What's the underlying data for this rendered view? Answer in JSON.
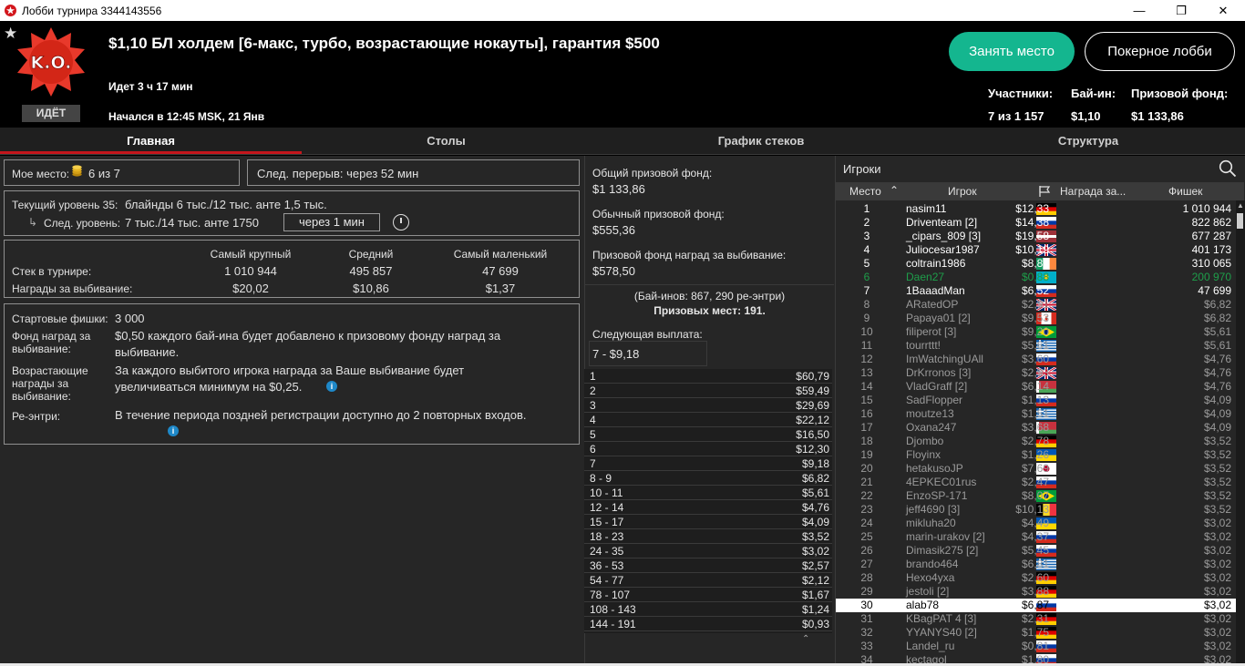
{
  "window": {
    "title": "Лобби турнира 3344143556"
  },
  "header": {
    "tournament_name": "$1,10 БЛ холдем [6-макс, турбо, возрастающие нокауты], гарантия $500",
    "logo_text": "K.O.",
    "status": "ИДЁТ",
    "running": "Идет 3 ч 17 мин",
    "started": "Начался в 12:45 MSK, 21 Янв",
    "take_seat": "Занять место",
    "poker_lobby": "Покерное лобби",
    "stats": [
      {
        "label": "Участники:",
        "value": "7 из 1 157"
      },
      {
        "label": "Бай-ин:",
        "value": "$1,10"
      },
      {
        "label": "Призовой фонд:",
        "value": "$1 133,86"
      }
    ]
  },
  "tabs": [
    "Главная",
    "Столы",
    "График стеков",
    "Структура"
  ],
  "main": {
    "my_place_label": "Мое место:",
    "my_place_value": "6 из 7",
    "next_break": "След. перерыв: через 52 мин",
    "current_level": "Текущий уровень 35:",
    "current_blinds": "блайнды 6 тыс./12 тыс. анте 1,5 тыс.",
    "next_level": "След. уровень:",
    "next_blinds": "7 тыс./14 тыс. анте 1750",
    "next_in": "через 1 мин",
    "stack_cols": [
      "Самый крупный",
      "Средний",
      "Самый маленький"
    ],
    "stack_rows": [
      {
        "label": "Стек в турнире:",
        "values": [
          "1 010 944",
          "495 857",
          "47 699"
        ]
      },
      {
        "label": "Награды за выбивание:",
        "values": [
          "$20,02",
          "$10,86",
          "$1,37"
        ]
      }
    ],
    "info": [
      {
        "label": "Стартовые фишки:",
        "text": "3 000"
      },
      {
        "label": "Фонд наград за выбивание:",
        "text": "$0,50 каждого бай-ина будет добавлено к призовому фонду наград за выбивание."
      },
      {
        "label": "Возрастающие награды за выбивание:",
        "text": "За каждого выбитого игрока награда за Ваше выбивание будет увеличиваться минимум на $0,25."
      },
      {
        "label": "Ре-энтри:",
        "text": "В течение периода поздней регистрации доступно до 2 повторных входов."
      }
    ]
  },
  "prize": {
    "total_label": "Общий призовой фонд:",
    "total": "$1 133,86",
    "regular_label": "Обычный призовой фонд:",
    "regular": "$555,36",
    "bounty_label": "Призовой фонд наград за выбивание:",
    "bounty": "$578,50",
    "buyins": "(Бай-инов: 867, 290 ре-энтри)",
    "paid_places": "Призовых мест: 191.",
    "next_payout_label": "Следующая выплата:",
    "next_payout": "7 - $9,18",
    "payouts": [
      [
        "1",
        "$60,79"
      ],
      [
        "2",
        "$59,49"
      ],
      [
        "3",
        "$29,69"
      ],
      [
        "4",
        "$22,12"
      ],
      [
        "5",
        "$16,50"
      ],
      [
        "6",
        "$12,30"
      ],
      [
        "7",
        "$9,18"
      ],
      [
        "8 - 9",
        "$6,82"
      ],
      [
        "10 - 11",
        "$5,61"
      ],
      [
        "12 - 14",
        "$4,76"
      ],
      [
        "15 - 17",
        "$4,09"
      ],
      [
        "18 - 23",
        "$3,52"
      ],
      [
        "24 - 35",
        "$3,02"
      ],
      [
        "36 - 53",
        "$2,57"
      ],
      [
        "54 - 77",
        "$2,12"
      ],
      [
        "78 - 107",
        "$1,67"
      ],
      [
        "108 - 143",
        "$1,24"
      ],
      [
        "144 - 191",
        "$0,93"
      ]
    ]
  },
  "players": {
    "title": "Игроки",
    "columns": [
      "Место",
      "Игрок",
      "Награда за...",
      "Фишек"
    ],
    "rows": [
      {
        "p": "1",
        "n": "nasim11",
        "f": "de",
        "b": "$12,33",
        "c": "1 010 944",
        "s": "in"
      },
      {
        "p": "2",
        "n": "Driventeam [2]",
        "f": "ru",
        "b": "$14,38",
        "c": "822 862",
        "s": "in"
      },
      {
        "p": "3",
        "n": "_cipars_809 [3]",
        "f": "lv",
        "b": "$19,58",
        "c": "677 287",
        "s": "in"
      },
      {
        "p": "4",
        "n": "Juliocesar1987",
        "f": "gb",
        "b": "$10,19",
        "c": "401 173",
        "s": "in"
      },
      {
        "p": "5",
        "n": "coltrain1986",
        "f": "ie",
        "b": "$8,89",
        "c": "310 065",
        "s": "in"
      },
      {
        "p": "6",
        "n": "Daen27",
        "f": "kz",
        "b": "$0,88",
        "c": "200 970",
        "s": "me"
      },
      {
        "p": "7",
        "n": "1BaaadMan",
        "f": "ru",
        "b": "$6,52",
        "c": "47 699",
        "s": "in"
      },
      {
        "p": "8",
        "n": "ARatedOP",
        "f": "gb",
        "b": "$2,91",
        "c": "$6,82",
        "s": "out"
      },
      {
        "p": "9",
        "n": "Papaya01 [2]",
        "f": "ca",
        "b": "$9,53",
        "c": "$6,82",
        "s": "out"
      },
      {
        "p": "10",
        "n": "filiperot [3]",
        "f": "br",
        "b": "$9,20",
        "c": "$5,61",
        "s": "out"
      },
      {
        "p": "11",
        "n": "tourrttt!",
        "f": "gr",
        "b": "$5,61",
        "c": "$5,61",
        "s": "out"
      },
      {
        "p": "12",
        "n": "ImWatchingUAll",
        "f": "ru",
        "b": "$3,60",
        "c": "$4,76",
        "s": "out"
      },
      {
        "p": "13",
        "n": "DrKrronos [3]",
        "f": "gb",
        "b": "$2,93",
        "c": "$4,76",
        "s": "out"
      },
      {
        "p": "14",
        "n": "VladGraff [2]",
        "f": "by",
        "b": "$6,14",
        "c": "$4,76",
        "s": "out"
      },
      {
        "p": "15",
        "n": "SadFlopper",
        "f": "ru",
        "b": "$1,13",
        "c": "$4,09",
        "s": "out"
      },
      {
        "p": "16",
        "n": "moutze13",
        "f": "gr",
        "b": "$1,51",
        "c": "$4,09",
        "s": "out"
      },
      {
        "p": "17",
        "n": "Oxana247",
        "f": "by",
        "b": "$3,68",
        "c": "$4,09",
        "s": "out"
      },
      {
        "p": "18",
        "n": "Djombo",
        "f": "de",
        "b": "$2,78",
        "c": "$3,52",
        "s": "out"
      },
      {
        "p": "19",
        "n": "Floyinx",
        "f": "ua",
        "b": "$1,26",
        "c": "$3,52",
        "s": "out"
      },
      {
        "p": "20",
        "n": "hetakusoJP",
        "f": "jp",
        "b": "$7,69",
        "c": "$3,52",
        "s": "out"
      },
      {
        "p": "21",
        "n": "4EPKEC01rus",
        "f": "ru",
        "b": "$2,47",
        "c": "$3,52",
        "s": "out"
      },
      {
        "p": "22",
        "n": "EnzoSP-171",
        "f": "br",
        "b": "$8,07",
        "c": "$3,52",
        "s": "out"
      },
      {
        "p": "23",
        "n": "jeff4690 [3]",
        "f": "be",
        "b": "$10,13",
        "c": "$3,52",
        "s": "out"
      },
      {
        "p": "24",
        "n": "mikluha20",
        "f": "ua",
        "b": "$4,49",
        "c": "$3,02",
        "s": "out"
      },
      {
        "p": "25",
        "n": "marin-urakov [2]",
        "f": "ru",
        "b": "$4,37",
        "c": "$3,02",
        "s": "out"
      },
      {
        "p": "26",
        "n": "Dimasik275 [2]",
        "f": "ru",
        "b": "$5,45",
        "c": "$3,02",
        "s": "out"
      },
      {
        "p": "27",
        "n": "brando464",
        "f": "gr",
        "b": "$6,81",
        "c": "$3,02",
        "s": "out"
      },
      {
        "p": "28",
        "n": "Hexo4yxa",
        "f": "de",
        "b": "$2,60",
        "c": "$3,02",
        "s": "out"
      },
      {
        "p": "29",
        "n": "jestoli [2]",
        "f": "de",
        "b": "$3,88",
        "c": "$3,02",
        "s": "out"
      },
      {
        "p": "30",
        "n": "alab78",
        "f": "ru",
        "b": "$6,87",
        "c": "$3,02",
        "s": "sel"
      },
      {
        "p": "31",
        "n": "KBagPAT 4 [3]",
        "f": "de",
        "b": "$2,31",
        "c": "$3,02",
        "s": "out"
      },
      {
        "p": "32",
        "n": "YYANYS40 [2]",
        "f": "de",
        "b": "$1,75",
        "c": "$3,02",
        "s": "out"
      },
      {
        "p": "33",
        "n": "Landel_ru",
        "f": "ru",
        "b": "$0,81",
        "c": "$3,02",
        "s": "out"
      },
      {
        "p": "34",
        "n": "kectagol",
        "f": "ru",
        "b": "$1,80",
        "c": "$3,02",
        "s": "out"
      }
    ]
  },
  "colors": {
    "accent_green": "#14b68f",
    "tab_red": "#c4161c",
    "hero_green": "#1e9e4a"
  }
}
